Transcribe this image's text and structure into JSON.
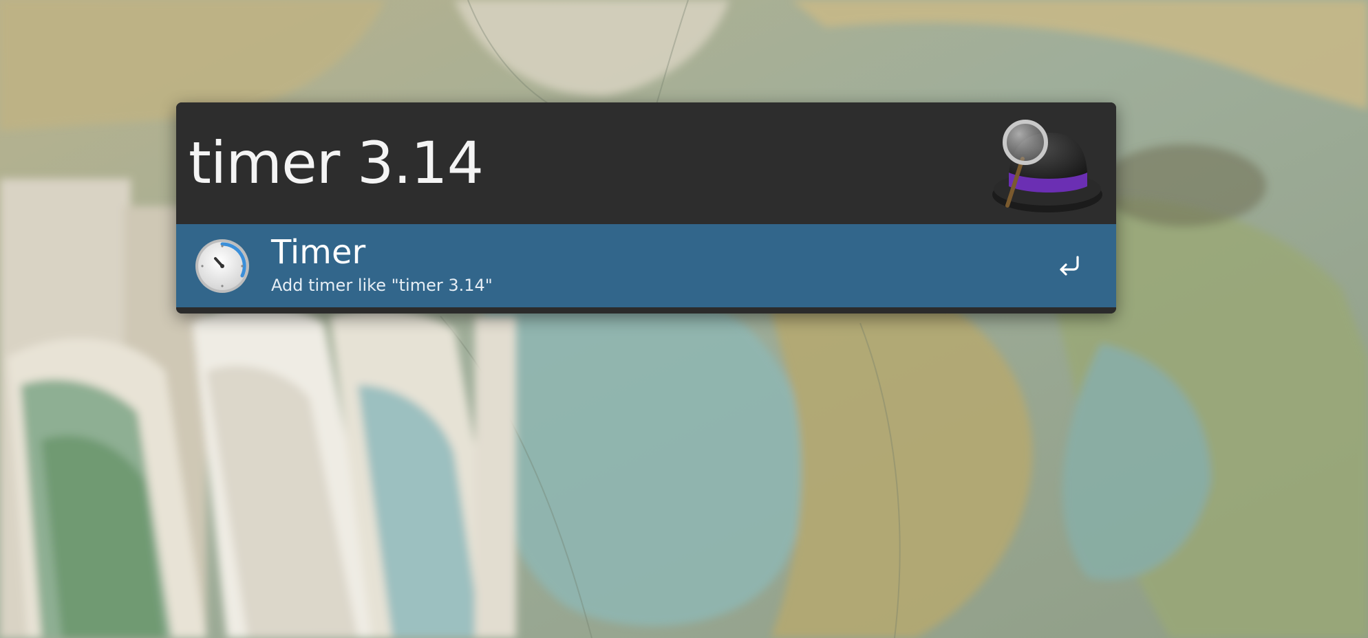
{
  "query": {
    "value": "timer 3.14"
  },
  "results": [
    {
      "title": "Timer",
      "subtitle": "Add timer like \"timer 3.14\"",
      "icon": "timer-icon",
      "action_icon": "return-key-icon"
    }
  ],
  "branding": {
    "logo": "alfred-hat-icon"
  },
  "colors": {
    "window_bg": "#2d2d2d",
    "selected_row": "#32668b",
    "text_primary": "#ffffff",
    "logo_band": "#6b2fb3"
  }
}
